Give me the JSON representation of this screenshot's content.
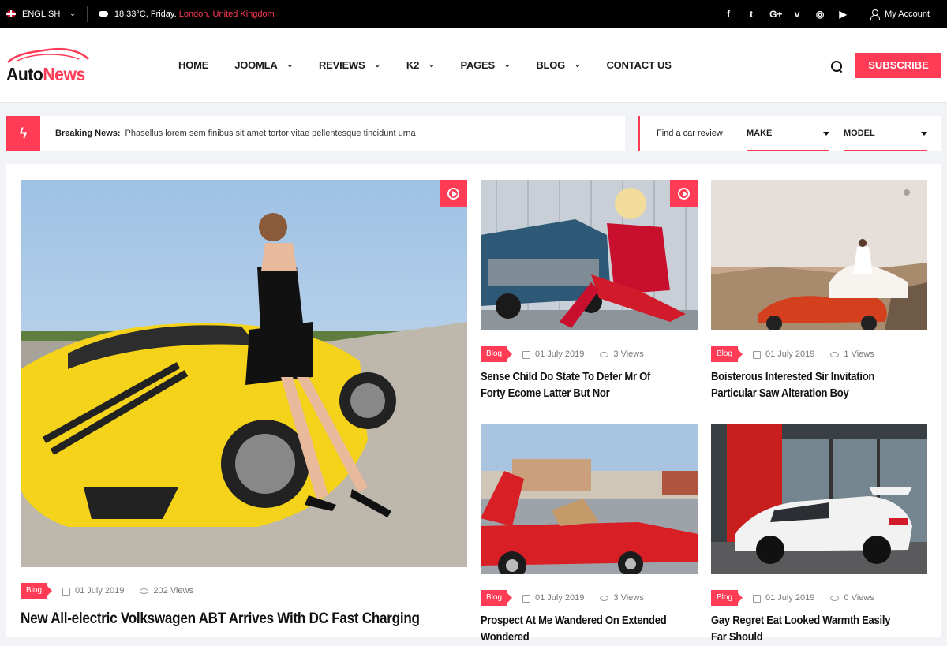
{
  "topbar": {
    "language": "ENGLISH",
    "weather_prefix": "18.33°C, Friday.",
    "location": "London, United Kingdom",
    "social": [
      {
        "name": "facebook-icon",
        "glyph": "f"
      },
      {
        "name": "twitter-icon",
        "glyph": "t"
      },
      {
        "name": "google-plus-icon",
        "glyph": "G+"
      },
      {
        "name": "vimeo-icon",
        "glyph": "v"
      },
      {
        "name": "instagram-icon",
        "glyph": "◎"
      },
      {
        "name": "youtube-icon",
        "glyph": "▶"
      }
    ],
    "account": "My Account"
  },
  "header": {
    "logo_part1": "Auto",
    "logo_part2": "News",
    "nav": [
      {
        "label": "HOME",
        "has_dropdown": false
      },
      {
        "label": "JOOMLA",
        "has_dropdown": true
      },
      {
        "label": "REVIEWS",
        "has_dropdown": true
      },
      {
        "label": "K2",
        "has_dropdown": true
      },
      {
        "label": "PAGES",
        "has_dropdown": true
      },
      {
        "label": "BLOG",
        "has_dropdown": true
      },
      {
        "label": "CONTACT US",
        "has_dropdown": false
      }
    ],
    "subscribe": "SUBSCRIBE"
  },
  "breaking": {
    "label": "Breaking News:",
    "text": "Phasellus lorem sem finibus sit amet tortor vitae pellentesque tincidunt urna"
  },
  "finder": {
    "label": "Find a car review",
    "make": "MAKE",
    "model": "MODEL"
  },
  "articles": [
    {
      "category": "Blog",
      "date": "01 July 2019",
      "views": "202 Views",
      "title": "New All-electric Volkswagen ABT Arrives With DC Fast Charging",
      "video": true
    },
    {
      "category": "Blog",
      "date": "01 July 2019",
      "views": "3 Views",
      "title": "Sense Child Do State To Defer Mr Of Forty Ecome Latter But Nor",
      "video": true
    },
    {
      "category": "Blog",
      "date": "01 July 2019",
      "views": "1 Views",
      "title": "Boisterous Interested Sir Invitation Particular Saw Alteration Boy",
      "video": false
    },
    {
      "category": "Blog",
      "date": "01 July 2019",
      "views": "3 Views",
      "title": "Prospect At Me Wandered On Extended Wondered",
      "video": false
    },
    {
      "category": "Blog",
      "date": "01 July 2019",
      "views": "0 Views",
      "title": "Gay Regret Eat Looked Warmth Easily Far Should",
      "video": false
    }
  ],
  "colors": {
    "accent": "#ff3b55",
    "topbar": "#000000"
  }
}
